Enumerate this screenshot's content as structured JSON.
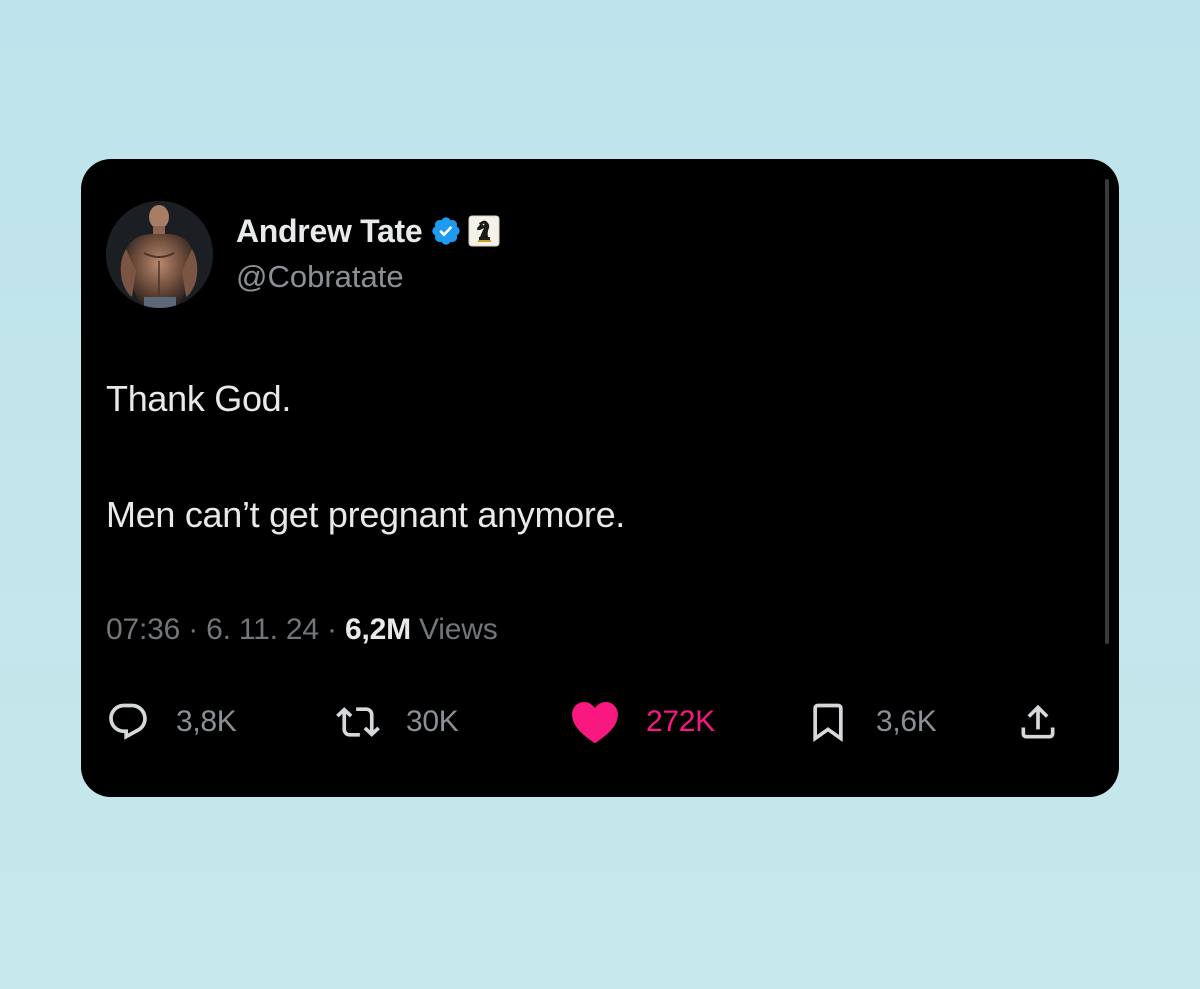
{
  "author": {
    "name": "Andrew Tate",
    "handle": "@Cobratate",
    "verified_icon": "verified-badge-icon",
    "affiliate_badge": "chess-knight-badge-icon"
  },
  "tweet": {
    "lines": [
      "Thank God.",
      "Men can’t get pregnant anymore."
    ]
  },
  "meta": {
    "time": "07:36",
    "separator": "·",
    "date": "6. 11. 24",
    "views_count": "6,2M",
    "views_label": "Views"
  },
  "actions": {
    "reply": {
      "icon": "reply-icon",
      "count": "3,8K"
    },
    "repost": {
      "icon": "repost-icon",
      "count": "30K"
    },
    "like": {
      "icon": "heart-icon",
      "count": "272K",
      "active": true
    },
    "bookmark": {
      "icon": "bookmark-icon",
      "count": "3,6K"
    },
    "share": {
      "icon": "share-icon"
    }
  },
  "colors": {
    "background": "#c2e5ec",
    "card": "#000000",
    "primary_text": "#e7e9ea",
    "secondary_text": "#71767b",
    "verified_blue": "#1d9bf0",
    "like_pink": "#f91880"
  }
}
